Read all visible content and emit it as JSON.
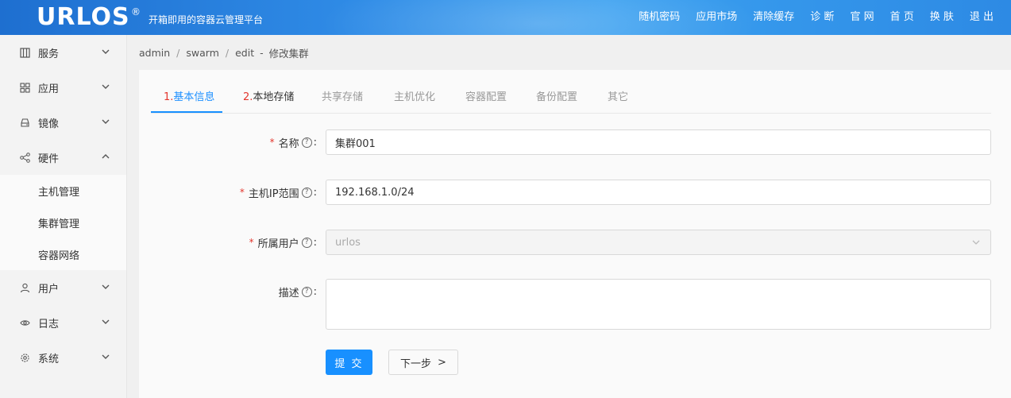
{
  "header": {
    "logo": "URLOS",
    "logo_mark": "®",
    "slogan": "开箱即用的容器云管理平台",
    "nav": [
      "随机密码",
      "应用市场",
      "清除缓存",
      "诊 断",
      "官 网",
      "首 页",
      "换 肤",
      "退 出"
    ]
  },
  "sidebar": {
    "items": [
      {
        "label": "服务",
        "icon": "service-icon",
        "expanded": false
      },
      {
        "label": "应用",
        "icon": "grid-icon",
        "expanded": false
      },
      {
        "label": "镜像",
        "icon": "drive-icon",
        "expanded": false
      },
      {
        "label": "硬件",
        "icon": "share-nodes-icon",
        "expanded": true
      },
      {
        "label": "用户",
        "icon": "user-icon",
        "expanded": false
      },
      {
        "label": "日志",
        "icon": "eye-icon",
        "expanded": false
      },
      {
        "label": "系统",
        "icon": "gear-icon",
        "expanded": false
      }
    ],
    "hardware_sub": [
      "主机管理",
      "集群管理",
      "容器网络"
    ]
  },
  "breadcrumb": {
    "items": [
      "admin",
      "swarm",
      "edit"
    ],
    "dash": "-",
    "current": "修改集群"
  },
  "tabs": [
    {
      "num": "1.",
      "label": "基本信息",
      "active": true
    },
    {
      "num": "2.",
      "label": "本地存储",
      "active": false
    },
    {
      "num": "",
      "label": "共享存储",
      "active": false
    },
    {
      "num": "",
      "label": "主机优化",
      "active": false
    },
    {
      "num": "",
      "label": "容器配置",
      "active": false
    },
    {
      "num": "",
      "label": "备份配置",
      "active": false
    },
    {
      "num": "",
      "label": "其它",
      "active": false
    }
  ],
  "form": {
    "name": {
      "label": "名称",
      "required": true,
      "value": "集群001"
    },
    "ip_range": {
      "label": "主机IP范围",
      "required": true,
      "value": "192.168.1.0/24"
    },
    "owner": {
      "label": "所属用户",
      "required": true,
      "value": "urlos"
    },
    "desc": {
      "label": "描述",
      "required": false,
      "value": ""
    },
    "help_glyph": "?",
    "colon": ":",
    "required_mark": "*"
  },
  "buttons": {
    "submit": "提 交",
    "next": "下一步",
    "next_arrow": ">"
  },
  "colors": {
    "primary": "#1890ff",
    "required": "#e3362d"
  }
}
